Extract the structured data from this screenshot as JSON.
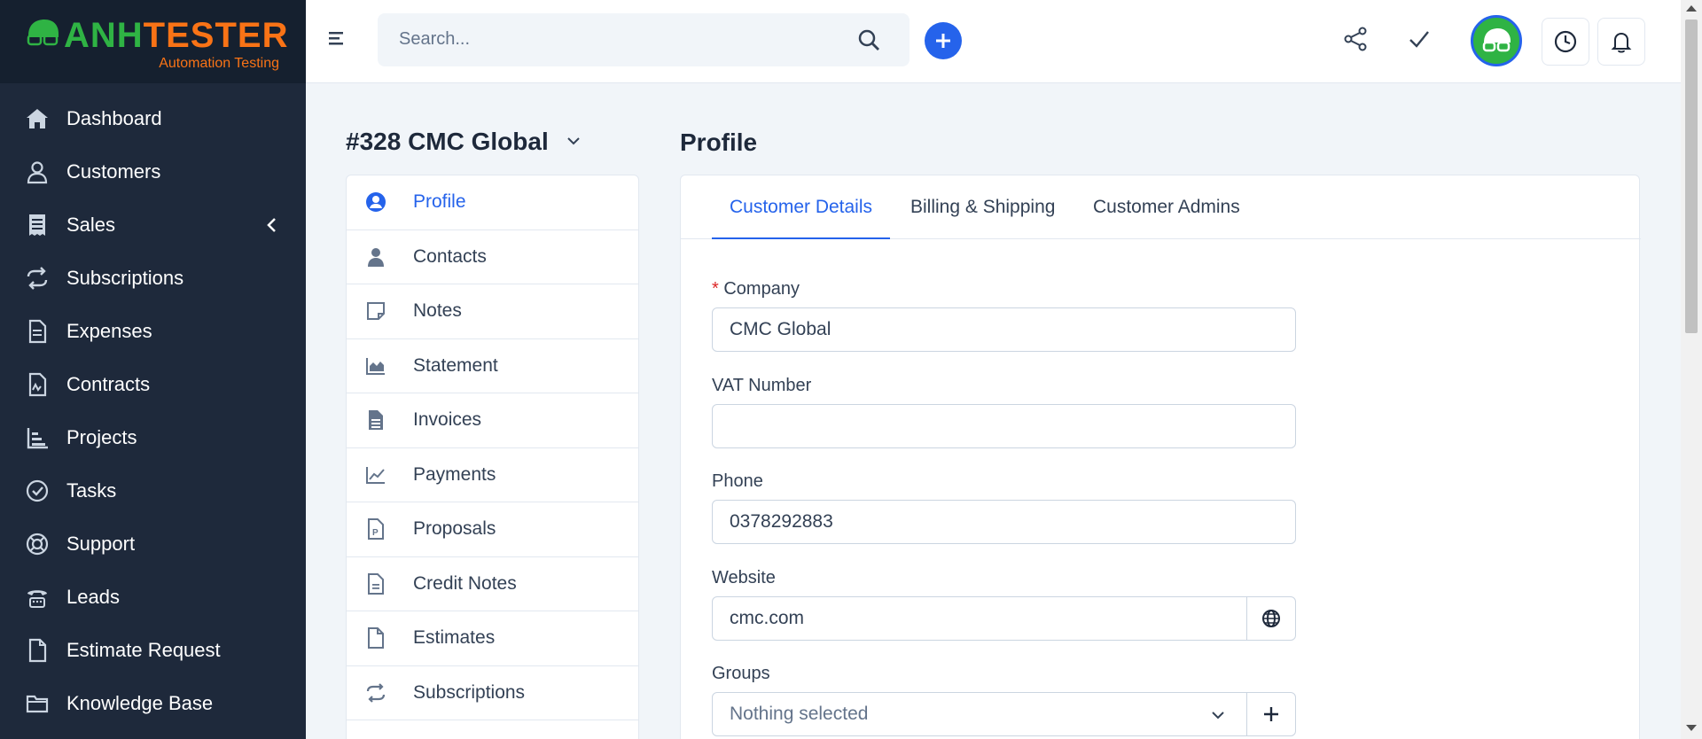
{
  "brand": {
    "title_part1": "ANH",
    "title_part2": "TESTER",
    "subtitle": "Automation Testing",
    "green": "#2fb344",
    "orange": "#f97316"
  },
  "sidebar": {
    "items": [
      {
        "label": "Dashboard",
        "icon": "home-icon"
      },
      {
        "label": "Customers",
        "icon": "user-icon"
      },
      {
        "label": "Sales",
        "icon": "receipt-icon"
      },
      {
        "label": "Subscriptions",
        "icon": "repeat-icon"
      },
      {
        "label": "Expenses",
        "icon": "file-text-icon"
      },
      {
        "label": "Contracts",
        "icon": "contract-icon"
      },
      {
        "label": "Projects",
        "icon": "chart-bars-icon"
      },
      {
        "label": "Tasks",
        "icon": "check-circle-icon"
      },
      {
        "label": "Support",
        "icon": "life-ring-icon"
      },
      {
        "label": "Leads",
        "icon": "tty-icon"
      },
      {
        "label": "Estimate Request",
        "icon": "file-icon"
      },
      {
        "label": "Knowledge Base",
        "icon": "folder-icon"
      }
    ]
  },
  "topbar": {
    "search_placeholder": "Search..."
  },
  "customer": {
    "title": "#328 CMC Global",
    "menu": [
      {
        "label": "Profile",
        "icon": "user-circle-icon",
        "active": true
      },
      {
        "label": "Contacts",
        "icon": "user-icon"
      },
      {
        "label": "Notes",
        "icon": "sticky-note-icon"
      },
      {
        "label": "Statement",
        "icon": "area-chart-icon"
      },
      {
        "label": "Invoices",
        "icon": "file-text-icon"
      },
      {
        "label": "Payments",
        "icon": "line-chart-icon"
      },
      {
        "label": "Proposals",
        "icon": "file-p-icon"
      },
      {
        "label": "Credit Notes",
        "icon": "file-lines-icon"
      },
      {
        "label": "Estimates",
        "icon": "file-icon"
      },
      {
        "label": "Subscriptions",
        "icon": "repeat-icon"
      }
    ]
  },
  "profile": {
    "title": "Profile",
    "tabs": [
      "Customer Details",
      "Billing & Shipping",
      "Customer Admins"
    ],
    "fields": {
      "company": {
        "label": "Company",
        "required_mark": "*",
        "value": "CMC Global"
      },
      "vat": {
        "label": "VAT Number",
        "value": ""
      },
      "phone": {
        "label": "Phone",
        "value": "0378292883"
      },
      "website": {
        "label": "Website",
        "value": "cmc.com"
      },
      "groups": {
        "label": "Groups",
        "value": "Nothing selected"
      }
    }
  },
  "colors": {
    "accent": "#2563eb",
    "sidebar_bg": "#1e293b",
    "page_bg": "#f1f5f9"
  }
}
